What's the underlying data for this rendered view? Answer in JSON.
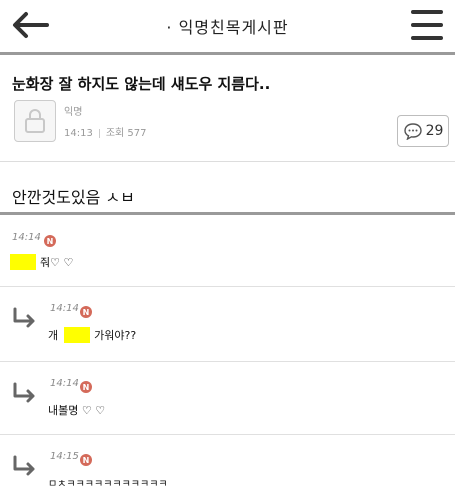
{
  "header": {
    "board_title": "· 익명친목게시판"
  },
  "post": {
    "title": "눈화장 잘 하지도 않는데 섀도우 지름다..",
    "author": "익명",
    "time": "14:13",
    "views_label": "조회",
    "views": "577",
    "comment_count": "29",
    "body": "안깐것도있음 ㅅㅂ"
  },
  "comments": [
    {
      "time": "14:14",
      "badge": "N",
      "text": "줘♡ ♡"
    },
    {
      "time": "14:14",
      "badge": "N",
      "text_before": "개",
      "text_after": "가워야??"
    },
    {
      "time": "14:14",
      "badge": "N",
      "text": "내볼명 ♡ ♡"
    },
    {
      "time": "14:15",
      "badge": "N",
      "text": "ㅁㅊㅋㅋㅋㅋㅋㅋㅋㅋㅋㅋㅋ"
    }
  ]
}
